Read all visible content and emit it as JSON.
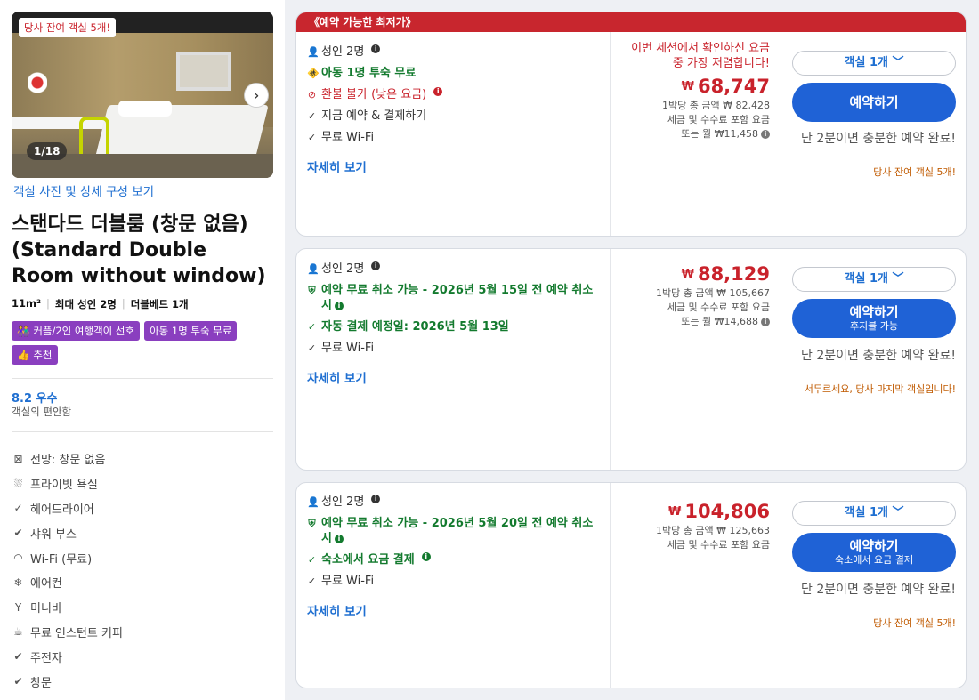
{
  "left": {
    "photo_badge": "당사 잔여 객실 5개!",
    "photo_count": "1/18",
    "gallery_link": "객실 사진 및 상세 구성 보기",
    "room_title": "스탠다드 더블룸 (창문 없음) (Standard Double Room without window)",
    "specs": [
      "11m²",
      "최대 성인 2명",
      "더블베드 1개"
    ],
    "tags": [
      "커플/2인 여행객이 선호",
      "아동 1명 투숙 무료",
      "추천"
    ],
    "rating": "8.2 우수",
    "rating_sub": "객실의 편안함",
    "amenities": [
      {
        "label": "전망: 창문 없음",
        "icon": "window-icon"
      },
      {
        "label": "프라이빗 욕실",
        "icon": "bath-icon"
      },
      {
        "label": "헤어드라이어",
        "icon": "check-icon"
      },
      {
        "label": "샤워 부스",
        "icon": "check-circle-icon"
      },
      {
        "label": "Wi-Fi (무료)",
        "icon": "wifi-icon"
      },
      {
        "label": "에어컨",
        "icon": "snowflake-icon"
      },
      {
        "label": "미니바",
        "icon": "cocktail-icon"
      },
      {
        "label": "무료 인스턴트 커피",
        "icon": "coffee-icon"
      },
      {
        "label": "주전자",
        "icon": "check-circle-icon"
      },
      {
        "label": "창문",
        "icon": "check-circle-icon"
      }
    ]
  },
  "offers": [
    {
      "banner": "《예약 가능한 최저가》",
      "adults": "성인 2명",
      "features": [
        {
          "text": "아동 1명 투숙 무료",
          "style": "green",
          "info": false
        },
        {
          "text": "환불 불가 (낮은 요금)",
          "style": "red",
          "info": true
        },
        {
          "text": "지금 예약 & 결제하기",
          "style": "plain",
          "info": false
        },
        {
          "text": "무료 Wi-Fi",
          "style": "plain",
          "info": false
        }
      ],
      "details": "자세히 보기",
      "lowest_note": "이번 세션에서 확인하신 요금 중 가장 저렴합니다!",
      "currency": "₩",
      "price": "68,747",
      "per_night": "1박당 총 금액 ₩ 82,428",
      "tax_note": "세금 및 수수료 포함 요금",
      "monthly": "또는 월 ₩11,458",
      "qty": "객실 1개",
      "book": "예약하기",
      "book_sub": "",
      "quick": "단 2분이면 충분한 예약 완료!",
      "scarcity": "당사 잔여 객실 5개!"
    },
    {
      "banner": "",
      "adults": "성인 2명",
      "features": [
        {
          "text": "예약 무료 취소 가능 - 2026년 5월 15일 전 예약 취소 시",
          "style": "green",
          "info": true
        },
        {
          "text": "자동 결제 예정일: 2026년 5월 13일",
          "style": "green",
          "info": false
        },
        {
          "text": "무료 Wi-Fi",
          "style": "plain",
          "info": false
        }
      ],
      "details": "자세히 보기",
      "lowest_note": "",
      "currency": "₩",
      "price": "88,129",
      "per_night": "1박당 총 금액 ₩ 105,667",
      "tax_note": "세금 및 수수료 포함 요금",
      "monthly": "또는 월 ₩14,688",
      "qty": "객실 1개",
      "book": "예약하기",
      "book_sub": "후지불 가능",
      "quick": "단 2분이면 충분한 예약 완료!",
      "scarcity": "서두르세요, 당사 마지막 객실입니다!"
    },
    {
      "banner": "",
      "adults": "성인 2명",
      "features": [
        {
          "text": "예약 무료 취소 가능 - 2026년 5월 20일 전 예약 취소 시",
          "style": "green",
          "info": true
        },
        {
          "text": "숙소에서 요금 결제",
          "style": "green",
          "info": true
        },
        {
          "text": "무료 Wi-Fi",
          "style": "plain",
          "info": false
        }
      ],
      "details": "자세히 보기",
      "lowest_note": "",
      "currency": "₩",
      "price": "104,806",
      "per_night": "1박당 총 금액 ₩ 125,663",
      "tax_note": "세금 및 수수료 포함 요금",
      "monthly": "",
      "qty": "객실 1개",
      "book": "예약하기",
      "book_sub": "숙소에서 요금 결제",
      "quick": "단 2분이면 충분한 예약 완료!",
      "scarcity": "당사 잔여 객실 5개!"
    }
  ],
  "colors": {
    "accent": "#1f62d6",
    "price": "#c9222b",
    "green": "#137a2e",
    "tag": "#8a3fbf",
    "scarcity": "#c05a00"
  }
}
